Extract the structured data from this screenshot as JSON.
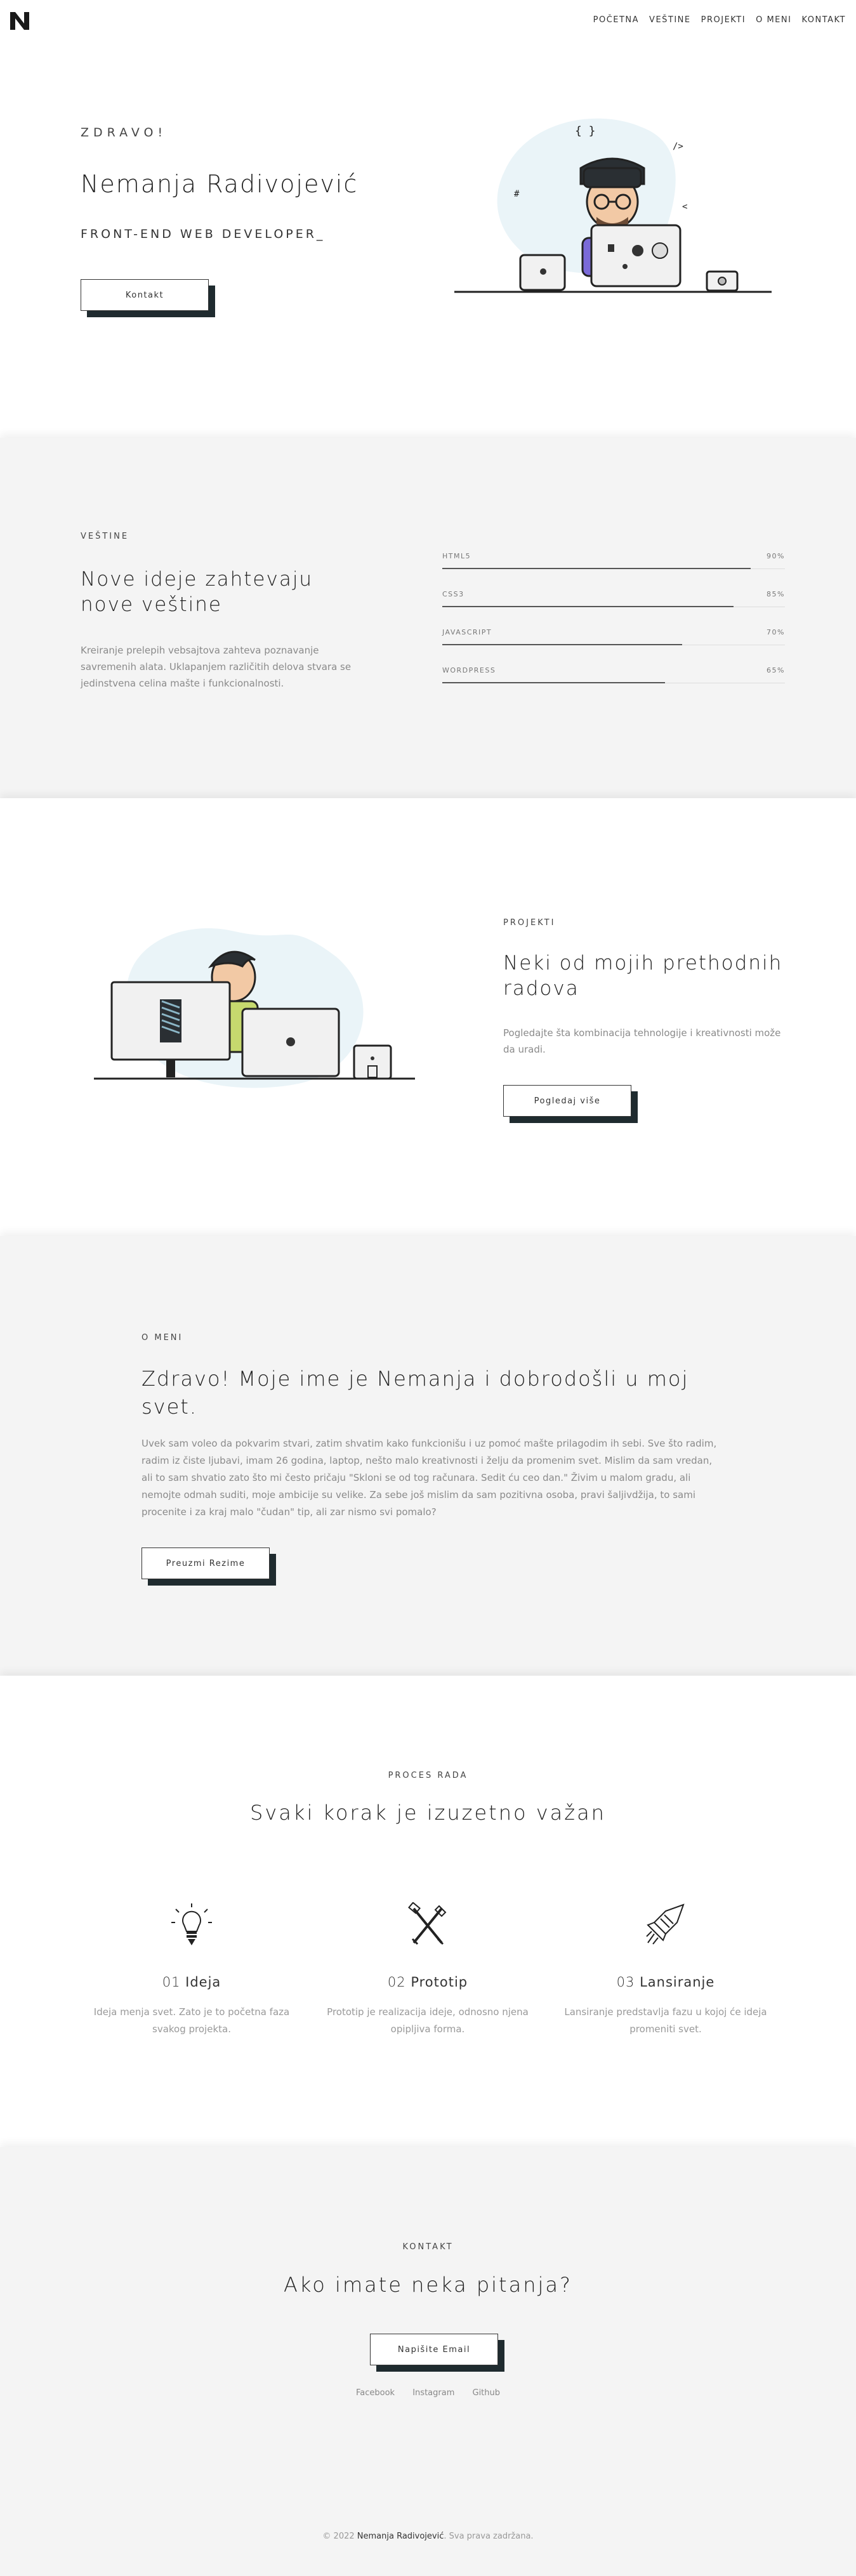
{
  "nav": {
    "logo": "N",
    "links": [
      "POČETNA",
      "VEŠTINE",
      "PROJEKTI",
      "O MENI",
      "KONTAKT"
    ]
  },
  "hero": {
    "greeting": "ZDRAVO!",
    "name": "Nemanja Radivojević",
    "role": "FRONT-END WEB DEVELOPER_",
    "button": "Kontakt"
  },
  "skills": {
    "eyebrow": "VEŠTINE",
    "title": "Nove ideje zahtevaju nove veštine",
    "description": "Kreiranje prelepih vebsajtova zahteva poznavanje savremenih alata. Uklapanjem različitih delova stvara se jedinstvena celina mašte i funkcionalnosti.",
    "items": [
      {
        "name": "HTML5",
        "percent": "90%",
        "value": 90
      },
      {
        "name": "CSS3",
        "percent": "85%",
        "value": 85
      },
      {
        "name": "JAVASCRIPT",
        "percent": "70%",
        "value": 70
      },
      {
        "name": "WORDPRESS",
        "percent": "65%",
        "value": 65
      }
    ]
  },
  "projects": {
    "eyebrow": "PROJEKTI",
    "title": "Neki od mojih prethodnih radova",
    "description": "Pogledajte šta kombinacija tehnologije i kreativnosti može da uradi.",
    "button": "Pogledaj više"
  },
  "about": {
    "eyebrow": "O MENI",
    "title": "Zdravo! Moje ime je Nemanja i dobrodošli u moj svet.",
    "description": "Uvek sam voleo da pokvarim stvari, zatim shvatim kako funkcionišu i uz pomoć mašte prilagodim ih sebi. Sve što radim, radim iz čiste ljubavi, imam 26 godina, laptop, nešto malo kreativnosti i želju da promenim svet. Mislim da sam vredan, ali to sam shvatio zato što mi često pričaju \"Skloni se od tog računara. Sedit ću ceo dan.\" Živim u malom gradu, ali nemojte odmah suditi, moje ambicije su velike. Za sebe još mislim da sam pozitivna osoba, pravi šaljivdžija, to sami procenite i za kraj malo \"čudan\" tip, ali zar nismo svi pomalo?",
    "button": "Preuzmi Rezime"
  },
  "process": {
    "eyebrow": "PROCES RADA",
    "title": "Svaki korak je izuzetno važan",
    "steps": [
      {
        "num": "01",
        "title": "Ideja",
        "text": "Ideja menja svet. Zato je to početna faza svakog projekta.",
        "icon": "lightbulb-icon"
      },
      {
        "num": "02",
        "title": "Prototip",
        "text": "Prototip je realizacija ideje, odnosno njena opipljiva forma.",
        "icon": "tools-icon"
      },
      {
        "num": "03",
        "title": "Lansiranje",
        "text": "Lansiranje predstavlja fazu u kojoj će ideja promeniti svet.",
        "icon": "rocket-icon"
      }
    ]
  },
  "contact": {
    "eyebrow": "KONTAKT",
    "title": "Ako imate neka pitanja?",
    "button": "Napišite Email",
    "socials": [
      "Facebook",
      "Instagram",
      "Github"
    ]
  },
  "footer": {
    "prefix": "© 2022",
    "name": "Nemanja Radivojević",
    "suffix": ". Sva prava zadržana."
  },
  "colors": {
    "accent_dark": "#1f2b2f",
    "blob": "#eaf4f8",
    "gray_section": "#f4f4f4"
  }
}
